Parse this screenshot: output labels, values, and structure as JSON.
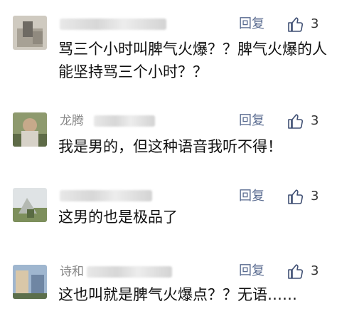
{
  "colors": {
    "username": "#8a8a8a",
    "reply": "#586a8f",
    "text": "#111111",
    "like_icon": "#3f4f73"
  },
  "comments": [
    {
      "username": "",
      "reply_label": "回复",
      "like_icon": "thumbs-up-icon",
      "likes": "3",
      "text": "骂三个小时叫脾气火爆？？脾气火爆的人能坚持骂三个小时？？"
    },
    {
      "username": "龙腾",
      "reply_label": "回复",
      "like_icon": "thumbs-up-icon",
      "likes": "3",
      "text": "我是男的，但这种语音我听不得！"
    },
    {
      "username": "",
      "reply_label": "回复",
      "like_icon": "thumbs-up-icon",
      "likes": "3",
      "text": "这男的也是极品了"
    },
    {
      "username": "诗和",
      "reply_label": "回复",
      "like_icon": "thumbs-up-icon",
      "likes": "3",
      "text": "这也叫就是脾气火爆点？？无语……"
    }
  ]
}
